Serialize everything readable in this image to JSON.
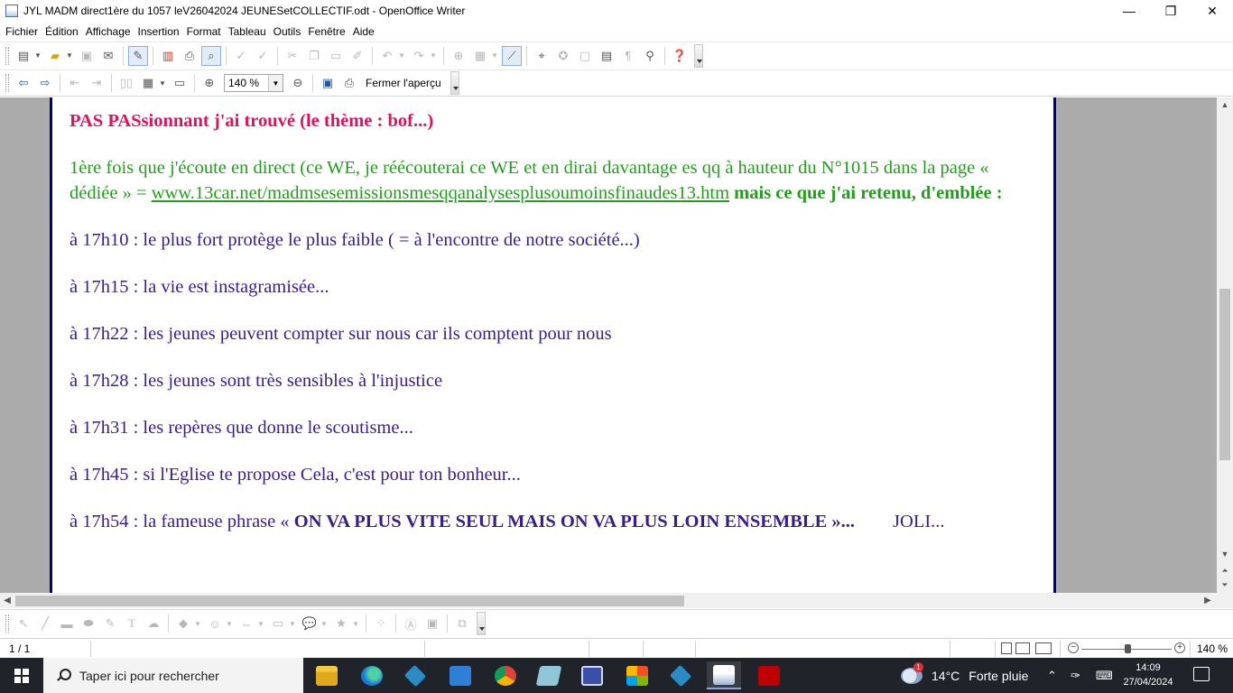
{
  "window": {
    "title": "JYL   MADM direct1ère du 1057 leV26042024 JEUNESetCOLLECTIF.odt - OpenOffice Writer",
    "min_glyph": "—",
    "max_glyph": "❐",
    "close_glyph": "✕"
  },
  "menu": {
    "items": [
      {
        "u": "F",
        "rest": "ichier"
      },
      {
        "u": "É",
        "rest": "dition"
      },
      {
        "u": "A",
        "rest": "ffichage"
      },
      {
        "u": "I",
        "rest": "nsertion"
      },
      {
        "u": "F",
        "rest": "ormat",
        "pre": ""
      },
      {
        "u": "T",
        "rest": "ableau"
      },
      {
        "u": "O",
        "rest": "utils"
      },
      {
        "u": "n",
        "rest": "être",
        "pre": "Fe"
      },
      {
        "u": "A",
        "rest": "ide"
      }
    ],
    "labels": [
      "Fichier",
      "Édition",
      "Affichage",
      "Insertion",
      "Format",
      "Tableau",
      "Outils",
      "Fenêtre",
      "Aide"
    ]
  },
  "preview_toolbar": {
    "zoom_value": "140 %",
    "close_preview_label": "Fermer l'aperçu"
  },
  "document": {
    "title_line": "PAS PASsionnant j'ai trouvé (le thème  : bof...)",
    "intro_text": "1ère fois que j'écoute en direct (ce WE, je réécouterai ce WE et en dirai davantage es qq  à hauteur du N°1015  dans la page « dédiée » = ",
    "intro_link": "www.13car.net/madmsesemissionsmesqqanalysesplusoumoinsfinaudes13.htm",
    "intro_bold": " mais ce que j'ai retenu, d'emblée :",
    "lines": [
      "à 17h10 :  le plus fort protège le plus faible ( = à l'encontre de notre société...)",
      "à 17h15 : la vie est instagramisée...",
      "à 17h22  : les jeunes peuvent compter sur nous car ils comptent pour nous",
      "à 17h28 : les jeunes sont très sensibles à l'injustice",
      "à 17h31 : les repères que donne le scoutisme...",
      "à 17h45 : si l'Eglise te propose Cela, c'est pour ton bonheur..."
    ],
    "last_line_prefix": "à 17h54 : la fameuse phrase « ",
    "last_line_bold": "ON VA PLUS VITE SEUL MAIS ON VA PLUS LOIN ENSEMBLE »...",
    "last_line_suffix": "JOLI..."
  },
  "statusbar": {
    "page_count": "1 / 1",
    "zoom": "140 %"
  },
  "taskbar": {
    "search_placeholder": "Taper ici pour rechercher",
    "weather_temp": "14°C",
    "weather_condition": "Forte pluie",
    "weather_badge": "1",
    "time": "14:09",
    "date": "27/04/2024"
  },
  "colors": {
    "title_pink": "#e0115f",
    "green": "#239e1c",
    "purple": "#3a1c8c",
    "page_border": "#000080"
  }
}
